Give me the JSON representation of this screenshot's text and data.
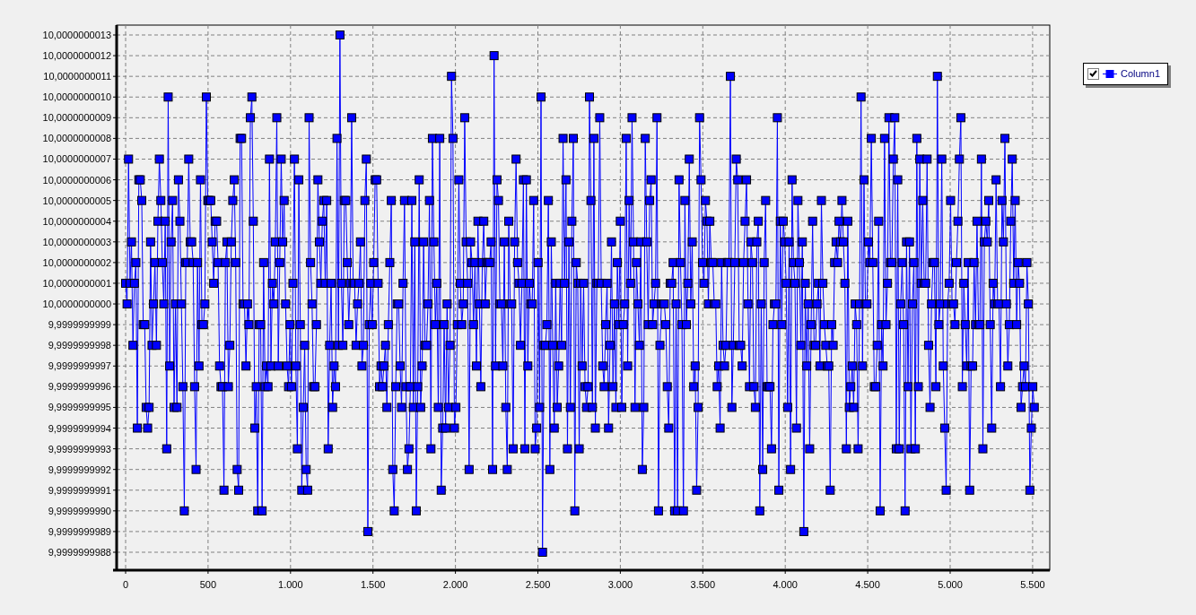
{
  "chart": {
    "y_tick_labels": [
      "10,0000000013",
      "10,0000000012",
      "10,0000000011",
      "10,0000000010",
      "10,0000000009",
      "10,0000000008",
      "10,0000000007",
      "10,0000000006",
      "10,0000000005",
      "10,0000000004",
      "10,0000000003",
      "10,0000000002",
      "10,0000000001",
      "10,0000000000",
      "9,9999999999",
      "9,9999999998",
      "9,9999999997",
      "9,9999999996",
      "9,9999999995",
      "9,9999999994",
      "9,9999999993",
      "9,9999999992",
      "9,9999999991",
      "9,9999999990",
      "9,9999999989",
      "9,9999999988"
    ],
    "x_tick_labels": [
      "0",
      "500",
      "1.000",
      "1.500",
      "2.000",
      "2.500",
      "3.000",
      "3.500",
      "4.000",
      "4.500",
      "5.000",
      "5.500"
    ],
    "legend": [
      {
        "label": "Column1",
        "checked": true,
        "color": "#0000ff"
      }
    ]
  }
}
